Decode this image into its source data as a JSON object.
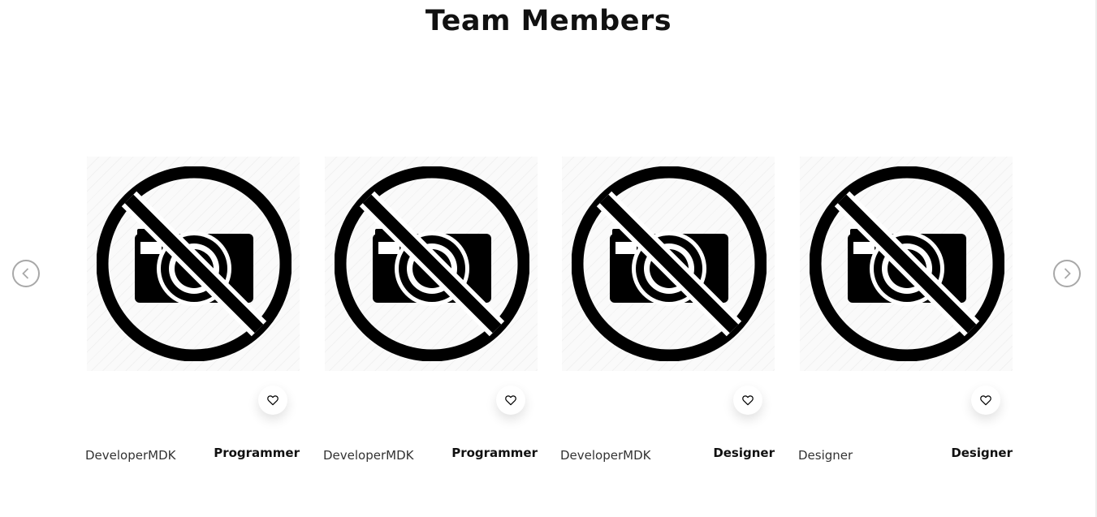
{
  "section": {
    "title": "Team Members"
  },
  "icons": {
    "prev": "chevron-left-icon",
    "next": "chevron-right-icon",
    "like": "heart-icon",
    "placeholder": "no-camera-icon"
  },
  "members": [
    {
      "name": "DeveloperMDK",
      "role": "Programmer"
    },
    {
      "name": "DeveloperMDK",
      "role": "Programmer"
    },
    {
      "name": "DeveloperMDK",
      "role": "Designer"
    },
    {
      "name": "Designer",
      "role": "Designer"
    }
  ]
}
